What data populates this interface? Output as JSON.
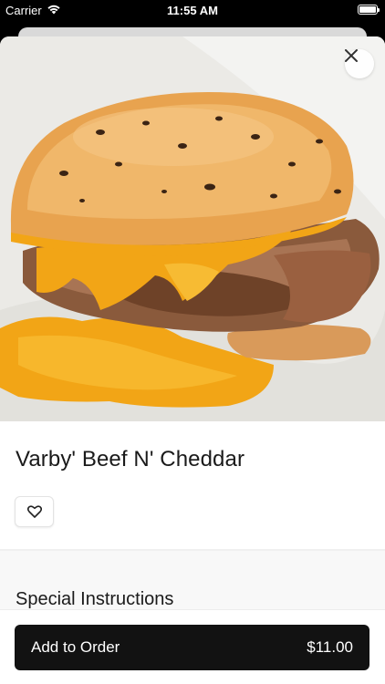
{
  "status_bar": {
    "carrier": "Carrier",
    "time": "11:55 AM",
    "wifi_icon": "wifi-icon",
    "battery_icon": "battery-icon"
  },
  "item": {
    "name": "Varby' Beef N' Cheddar",
    "image_alt": "beef-and-cheddar-sandwich-photo"
  },
  "actions": {
    "close_icon": "close-icon",
    "favorite_icon": "heart-icon"
  },
  "sections": {
    "special_instructions_title": "Special Instructions"
  },
  "order_button": {
    "label": "Add to Order",
    "price": "$11.00"
  },
  "colors": {
    "button_bg": "#121212",
    "cheese": "#f2a516",
    "bun": "#e8a34f"
  }
}
